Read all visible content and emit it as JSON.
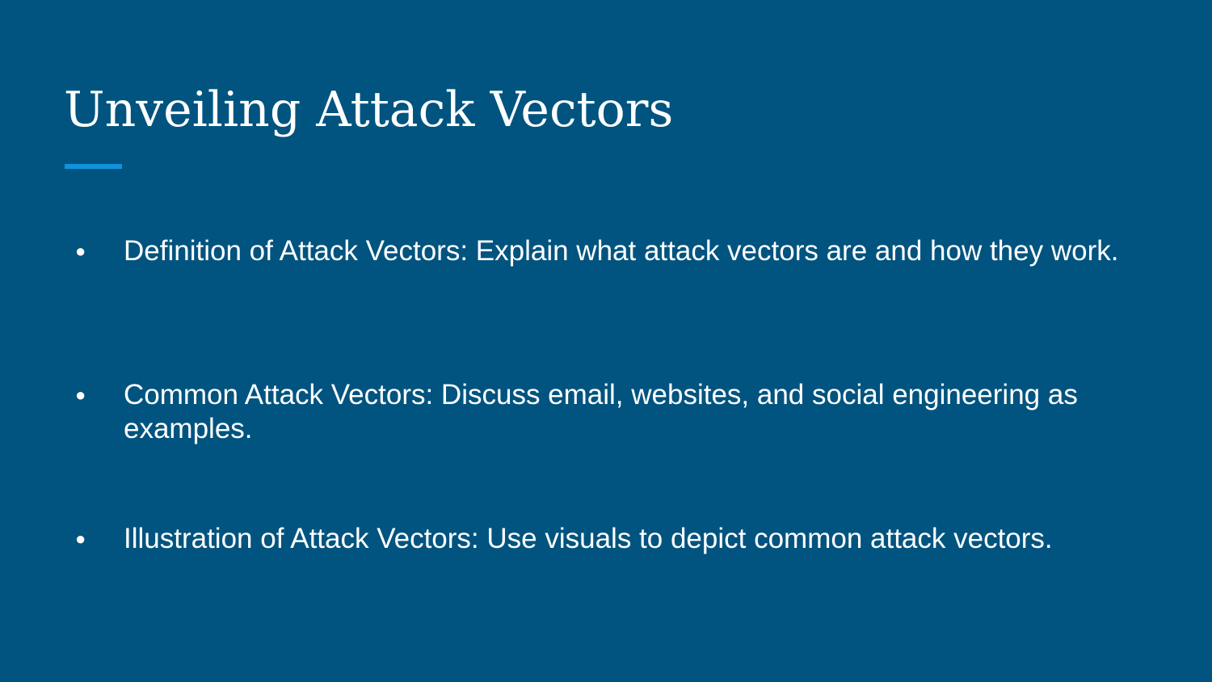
{
  "slide": {
    "title": "Unveiling Attack Vectors",
    "bullet_glyph": "●",
    "bullets": [
      {
        "text": "Definition of Attack Vectors: Explain what attack vectors are and how they work."
      },
      {
        "text": "Common Attack Vectors: Discuss email, websites, and social engineering as examples."
      },
      {
        "text": "Illustration of Attack Vectors: Use visuals to depict common attack vectors."
      }
    ]
  },
  "colors": {
    "background": "#01547f",
    "text": "#ffffff",
    "accent": "#0f94dd"
  }
}
